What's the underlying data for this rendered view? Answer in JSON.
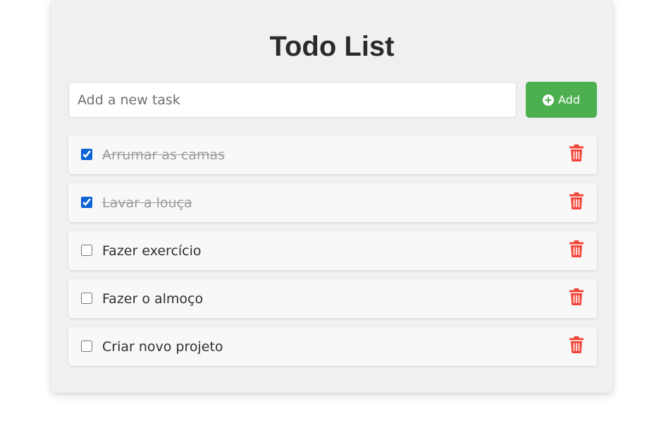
{
  "app": {
    "title": "Todo List"
  },
  "input": {
    "placeholder": "Add a new task",
    "value": ""
  },
  "add_button": {
    "label": "Add",
    "icon": "plus-circle-icon",
    "color": "#4caf50"
  },
  "tasks": [
    {
      "label": "Arrumar as camas",
      "completed": true
    },
    {
      "label": "Lavar a louça",
      "completed": true
    },
    {
      "label": "Fazer exercício",
      "completed": false
    },
    {
      "label": "Fazer o almoço",
      "completed": false
    },
    {
      "label": "Criar novo projeto",
      "completed": false
    }
  ],
  "delete_icon": {
    "name": "trash-icon",
    "color": "#f44336"
  },
  "colors": {
    "card_background": "#f0f0f0",
    "task_background": "#f8f8f8",
    "checkbox_accent": "#0b63d6",
    "completed_text": "#9a9a9a"
  }
}
